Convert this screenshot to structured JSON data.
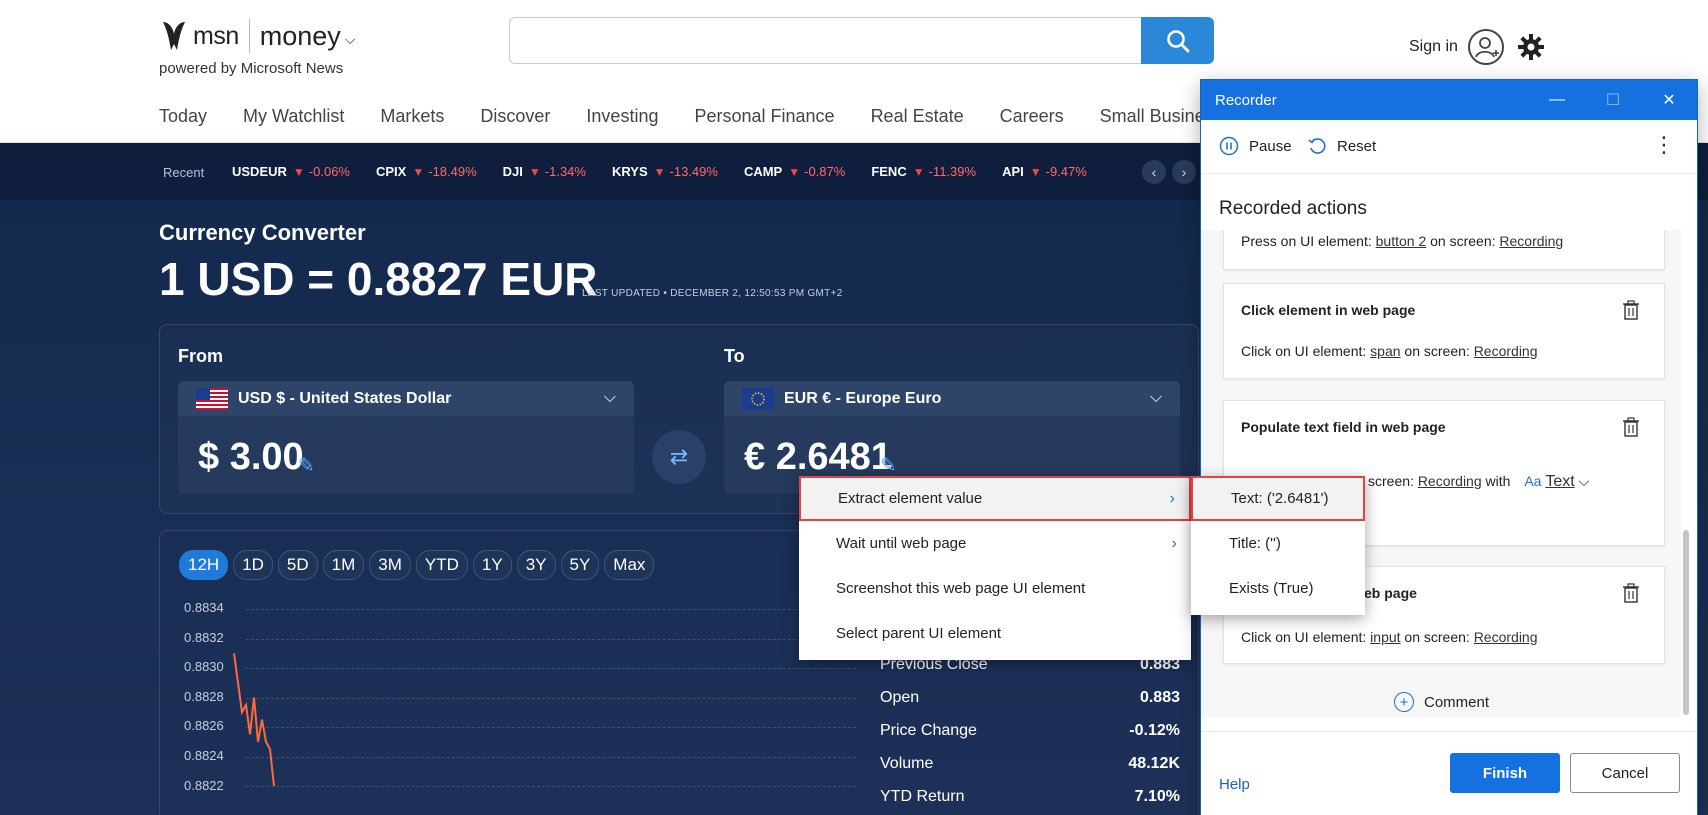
{
  "header": {
    "brand_msn": "msn",
    "brand_money": "money",
    "powered_by": "powered by Microsoft News",
    "sign_in": "Sign in",
    "nav": [
      "Today",
      "My Watchlist",
      "Markets",
      "Discover",
      "Investing",
      "Personal Finance",
      "Real Estate",
      "Careers",
      "Small Busine"
    ]
  },
  "ticker": {
    "recent_label": "Recent",
    "items": [
      {
        "symbol": "USDEUR",
        "change": "-0.06%"
      },
      {
        "symbol": "CPIX",
        "change": "-18.49%"
      },
      {
        "symbol": "DJI",
        "change": "-1.34%"
      },
      {
        "symbol": "KRYS",
        "change": "-13.49%"
      },
      {
        "symbol": "CAMP",
        "change": "-0.87%"
      },
      {
        "symbol": "FENC",
        "change": "-11.39%"
      },
      {
        "symbol": "API",
        "change": "-9.47%"
      }
    ]
  },
  "converter": {
    "title": "Currency Converter",
    "rate": "1 USD = 0.8827 EUR",
    "last_updated": "LAST UPDATED • DECEMBER 2, 12:50:53 PM GMT+2",
    "from_label": "From",
    "to_label": "To",
    "from_currency": "USD $ - United States Dollar",
    "to_currency": "EUR € - Europe Euro",
    "from_amount": "$ 3.00",
    "to_amount": "€ 2.6481"
  },
  "chart": {
    "periods": [
      "12H",
      "1D",
      "5D",
      "1M",
      "3M",
      "YTD",
      "1Y",
      "3Y",
      "5Y",
      "Max"
    ],
    "active_period": "12H",
    "y_ticks": [
      "0.8834",
      "0.8832",
      "0.8830",
      "0.8828",
      "0.8826",
      "0.8824",
      "0.8822"
    ]
  },
  "chart_data": {
    "type": "line",
    "title": "",
    "xlabel": "",
    "ylabel": "",
    "ylim": [
      0.8821,
      0.8835
    ],
    "series": [
      {
        "values": [
          0.8831,
          0.8829,
          0.8827,
          0.88275,
          0.88255,
          0.8828,
          0.8825,
          0.88265,
          0.8825,
          0.88245,
          0.8822
        ]
      }
    ]
  },
  "stats": [
    {
      "label": "Previous Close",
      "value": "0.883"
    },
    {
      "label": "Open",
      "value": "0.883"
    },
    {
      "label": "Price Change",
      "value": "-0.12%"
    },
    {
      "label": "Volume",
      "value": "48.12K"
    },
    {
      "label": "YTD Return",
      "value": "7.10%"
    }
  ],
  "context_menu": {
    "items": [
      "Extract element value",
      "Wait until web page",
      "Screenshot this web page UI element",
      "Select parent UI element"
    ],
    "submenu": [
      "Text:  ('2.6481')",
      "Title:  ('')",
      "Exists (True)"
    ]
  },
  "recorder": {
    "title": "Recorder",
    "pause": "Pause",
    "reset": "Reset",
    "heading": "Recorded actions",
    "actions": [
      {
        "title": "",
        "prefix": "Press on UI element:",
        "element": "button 2",
        "mid": "on screen:",
        "screen": "Recording"
      },
      {
        "title": "Click element in web page",
        "prefix": "Click on UI element:",
        "element": "span",
        "mid": "on screen:",
        "screen": "Recording"
      },
      {
        "title": "Populate text field in web page",
        "prefix": "screen:",
        "element": "",
        "mid": "",
        "screen": "Recording",
        "with": "with",
        "text": "Text"
      },
      {
        "title": "eb page",
        "prefix": "Click on UI element:",
        "element": "input",
        "mid": "on screen:",
        "screen": "Recording"
      }
    ],
    "comment": "Comment",
    "help": "Help",
    "finish": "Finish",
    "cancel": "Cancel"
  }
}
